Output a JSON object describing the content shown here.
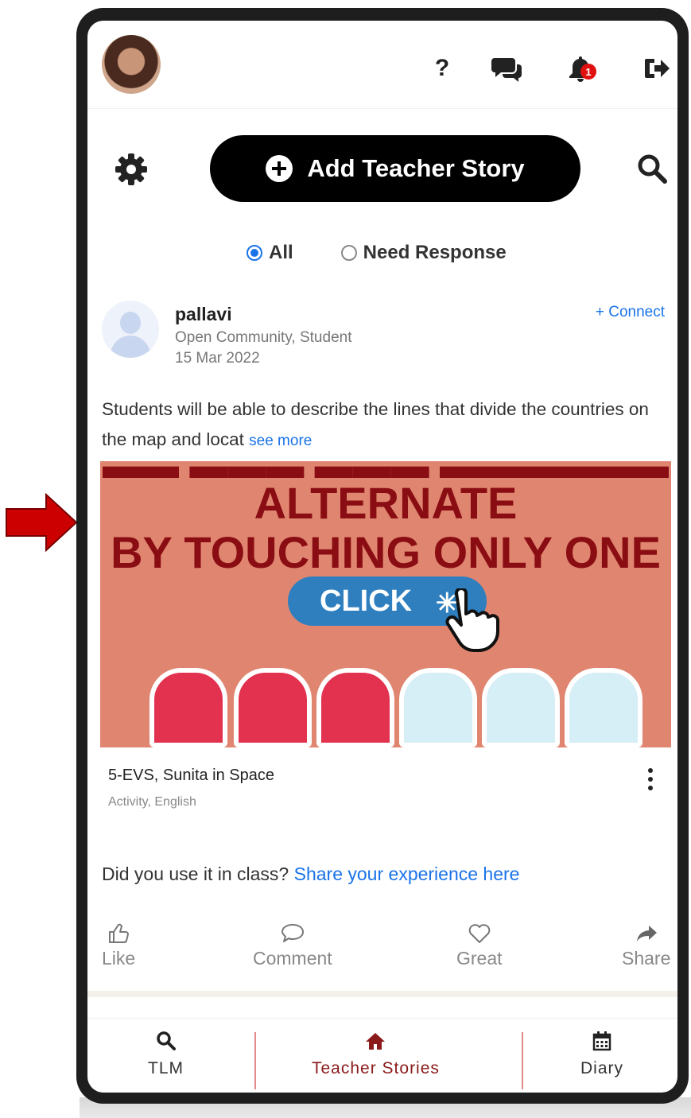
{
  "header": {
    "help_label": "?",
    "notification_count": "1"
  },
  "toolbar": {
    "add_story_label": "Add Teacher Story"
  },
  "filter": {
    "options": [
      "All",
      "Need Response"
    ],
    "selected": "All"
  },
  "post": {
    "author": "pallavi",
    "community": "Open Community, Student",
    "date": "15 Mar 2022",
    "connect_label": "+ Connect",
    "text": "Students will be able to describe the lines that divide the countries on the map and locat",
    "see_more_label": "see more",
    "media": {
      "line1": "ALTERNATE",
      "line2": "BY TOUCHING ONLY ONE",
      "button": "CLICK"
    },
    "resource_title": "5-EVS, Sunita in Space",
    "resource_tags": "Activity, English",
    "use_question": "Did you use it in class?",
    "use_link": "Share your experience here",
    "reactions": [
      "Like",
      "Comment",
      "Great",
      "Share"
    ]
  },
  "bottom_nav": {
    "items": [
      "TLM",
      "Teacher Stories",
      "Diary"
    ],
    "active": "Teacher Stories"
  },
  "colors": {
    "accent": "#1a73e8",
    "active_nav": "#8b1a1a",
    "media_bg": "#e08670",
    "media_text": "#8b0d14",
    "arrow": "#cc0000"
  }
}
